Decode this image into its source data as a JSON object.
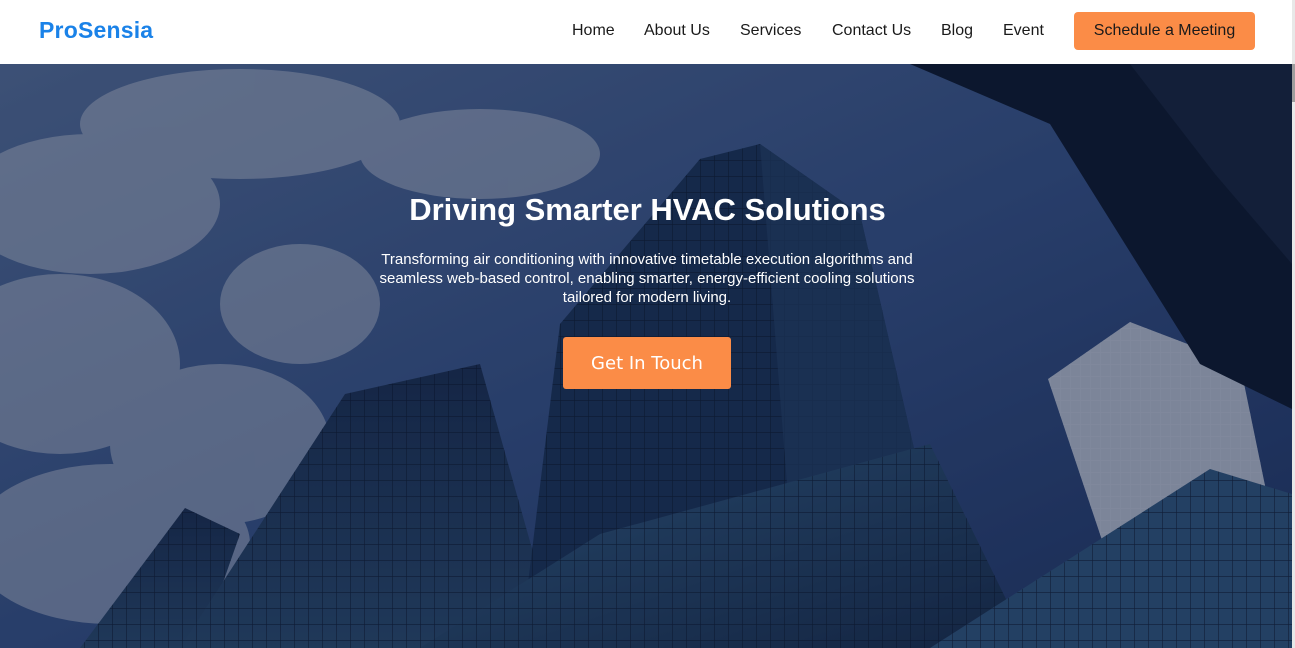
{
  "brand": {
    "name": "ProSensia",
    "color": "#1a82e8"
  },
  "nav": {
    "items": [
      {
        "label": "Home"
      },
      {
        "label": "About Us"
      },
      {
        "label": "Services"
      },
      {
        "label": "Contact Us"
      },
      {
        "label": "Blog"
      },
      {
        "label": "Event"
      }
    ],
    "cta_label": "Schedule a Meeting"
  },
  "hero": {
    "title": "Driving Smarter HVAC Solutions",
    "text": "Transforming air conditioning with innovative timetable execution algorithms and seamless web-based control, enabling smarter, energy-efficient cooling solutions tailored for modern living.",
    "button_label": "Get In Touch"
  },
  "colors": {
    "accent": "#fb8c47",
    "header_bg": "#ffffff"
  }
}
